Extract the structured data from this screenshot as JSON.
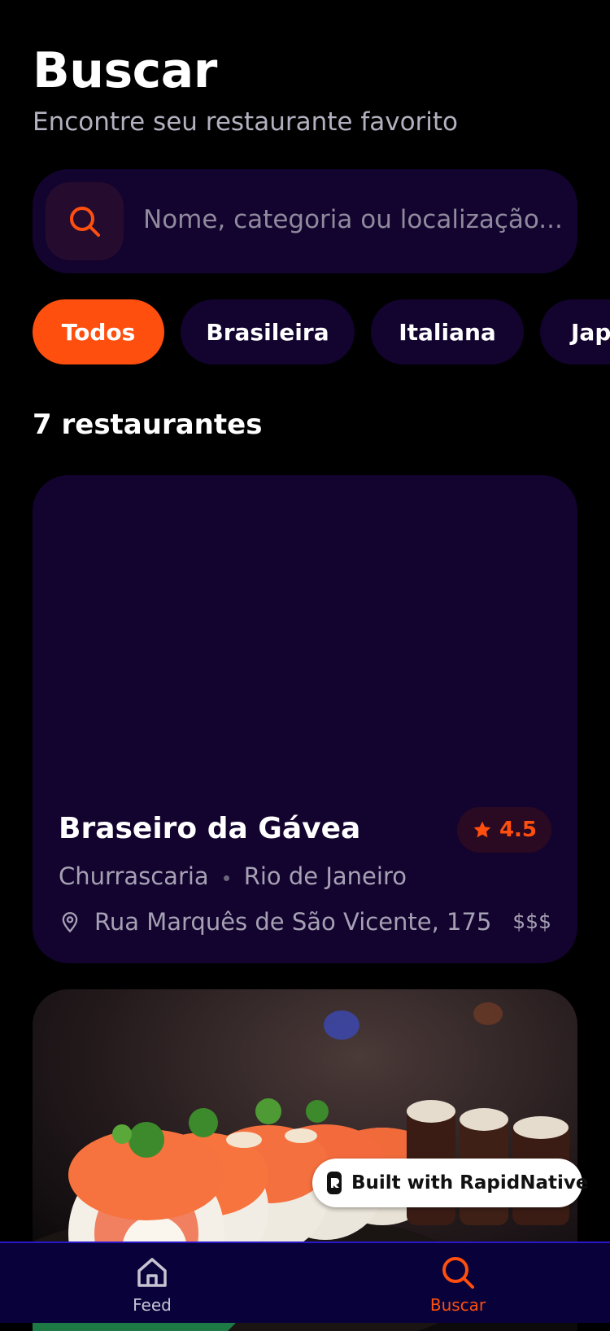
{
  "header": {
    "title": "Buscar",
    "subtitle": "Encontre seu restaurante favorito"
  },
  "search": {
    "icon": "search-icon",
    "placeholder": "Nome, categoria ou localização..."
  },
  "filters": {
    "chips": [
      {
        "label": "Todos",
        "active": true
      },
      {
        "label": "Brasileira",
        "active": false
      },
      {
        "label": "Italiana",
        "active": false
      },
      {
        "label": "Japonesa",
        "active": false
      }
    ]
  },
  "results": {
    "count_label": "7 restaurantes",
    "cards": [
      {
        "name": "Braseiro da Gávea",
        "rating": "4.5",
        "category": "Churrascaria",
        "city": "Rio de Janeiro",
        "address": "Rua Marquês de São Vicente, 175",
        "price": "$$$"
      }
    ]
  },
  "badge": {
    "label": "Built with RapidNative"
  },
  "tabbar": {
    "items": [
      {
        "label": "Feed",
        "icon": "home-icon",
        "active": false
      },
      {
        "label": "Buscar",
        "icon": "search-icon",
        "active": true
      }
    ]
  },
  "colors": {
    "background": "#000000",
    "surface": "#13032f",
    "accent": "#ff4f0f",
    "muted_text": "#a5a1b3",
    "tabbar": "#08013a"
  }
}
